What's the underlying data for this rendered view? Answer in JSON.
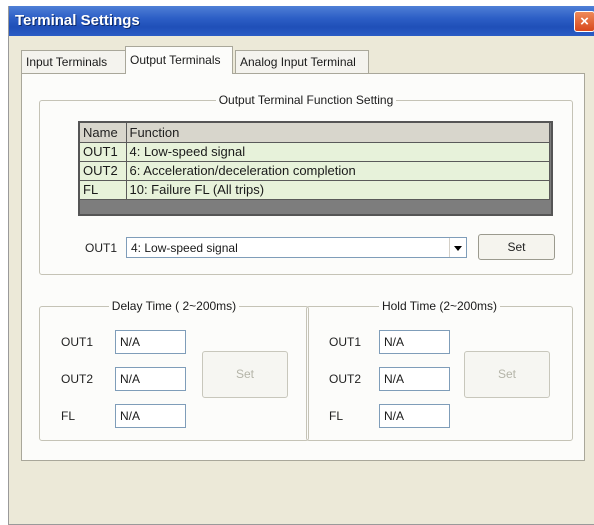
{
  "window": {
    "title": "Terminal Settings",
    "close_glyph": "×"
  },
  "tabs": [
    {
      "label": "Input Terminals",
      "active": false
    },
    {
      "label": "Output Terminals",
      "active": true
    },
    {
      "label": "Analog Input Terminal",
      "active": false
    }
  ],
  "output_function": {
    "legend": "Output Terminal Function Setting",
    "table": {
      "headers": [
        "Name",
        "Function"
      ],
      "rows": [
        {
          "name": "OUT1",
          "function": "4: Low-speed signal"
        },
        {
          "name": "OUT2",
          "function": "6: Acceleration/deceleration completion"
        },
        {
          "name": "FL",
          "function": "10: Failure FL (All trips)"
        }
      ]
    },
    "selector": {
      "label": "OUT1",
      "value": "4: Low-speed signal",
      "icon": "chevron-down-icon"
    },
    "set_label": "Set"
  },
  "delay_time": {
    "legend": "Delay Time ( 2~200ms)",
    "fields": [
      {
        "label": "OUT1",
        "value": "N/A"
      },
      {
        "label": "OUT2",
        "value": "N/A"
      },
      {
        "label": "FL",
        "value": "N/A"
      }
    ],
    "set_label": "Set"
  },
  "hold_time": {
    "legend": "Hold Time (2~200ms)",
    "fields": [
      {
        "label": "OUT1",
        "value": "N/A"
      },
      {
        "label": "OUT2",
        "value": "N/A"
      },
      {
        "label": "FL",
        "value": "N/A"
      }
    ],
    "set_label": "Set"
  },
  "colors": {
    "titlebar": "#2d5fc6",
    "dialog_bg": "#ece9d8",
    "table_row_bg": "#e7f2da",
    "close_button": "#d8481c"
  }
}
